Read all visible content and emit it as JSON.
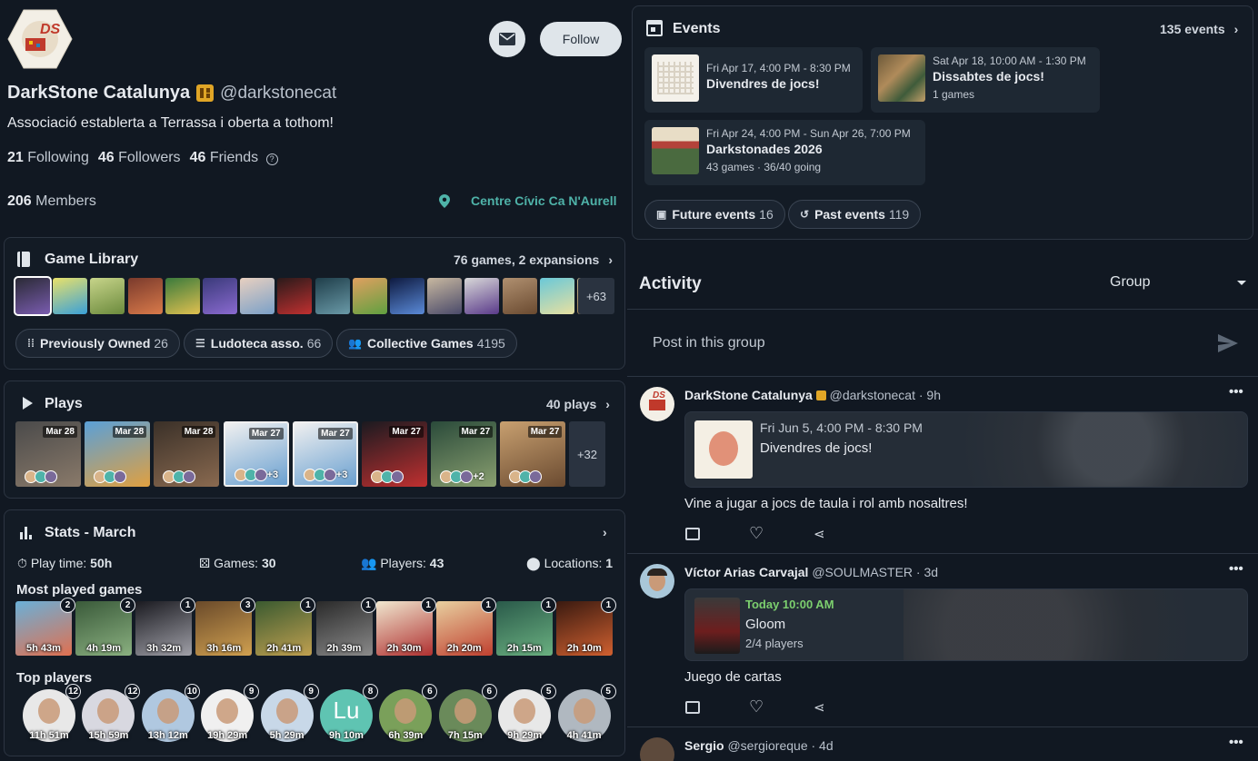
{
  "profile": {
    "name": "DarkStone Catalunya",
    "handle": "@darkstonecat",
    "bio": "Associació establerta a Terrassa i oberta a tothom!",
    "following_count": "21",
    "following_label": "Following",
    "followers_count": "46",
    "followers_label": "Followers",
    "friends_count": "46",
    "friends_label": "Friends",
    "members_count": "206",
    "members_label": "Members",
    "location": "Centre Cívic Ca N'Aurell",
    "follow_label": "Follow",
    "logo_text": "DS"
  },
  "events": {
    "title": "Events",
    "count_label": "135 events",
    "items": [
      {
        "date": "Fri Apr 17, 4:00 PM - 8:30 PM",
        "name": "Divendres de jocs!",
        "sub": ""
      },
      {
        "date": "Sat Apr 18, 10:00 AM - 1:30 PM",
        "name": "Dissabtes de jocs!",
        "sub": "1 games"
      },
      {
        "date": "Fri Apr 24, 4:00 PM - Sun Apr 26, 7:00 PM",
        "name": "Darkstonades 2026",
        "sub": "43 games · 36/40 going"
      }
    ],
    "future_label": "Future events",
    "future_count": "16",
    "past_label": "Past events",
    "past_count": "119"
  },
  "library": {
    "title": "Game Library",
    "count_label": "76 games, 2 expansions",
    "more": "+63",
    "chips": [
      {
        "label": "Previously Owned",
        "count": "26"
      },
      {
        "label": "Ludoteca asso.",
        "count": "66"
      },
      {
        "label": "Collective Games",
        "count": "4195"
      }
    ]
  },
  "plays": {
    "title": "Plays",
    "count_label": "40 plays",
    "more": "+32",
    "dates": [
      "Mar 28",
      "Mar 28",
      "Mar 28",
      "Mar 27",
      "Mar 27",
      "Mar 27",
      "Mar 27",
      "Mar 27"
    ],
    "extra": [
      "",
      "",
      "",
      "+3",
      "+3",
      "",
      "+2",
      ""
    ]
  },
  "stats": {
    "title": "Stats - March",
    "playtime_label": "Play time:",
    "playtime": "50h",
    "games_label": "Games:",
    "games": "30",
    "players_label": "Players:",
    "players": "43",
    "locations_label": "Locations:",
    "locations": "1",
    "most_played_title": "Most played games",
    "most_played": [
      {
        "time": "5h 43m",
        "count": "2"
      },
      {
        "time": "4h 19m",
        "count": "2"
      },
      {
        "time": "3h 32m",
        "count": "1"
      },
      {
        "time": "3h 16m",
        "count": "3"
      },
      {
        "time": "2h 41m",
        "count": "1"
      },
      {
        "time": "2h 39m",
        "count": "1"
      },
      {
        "time": "2h 30m",
        "count": "1"
      },
      {
        "time": "2h 20m",
        "count": "1"
      },
      {
        "time": "2h 15m",
        "count": "1"
      },
      {
        "time": "2h 10m",
        "count": "1"
      }
    ],
    "top_players_title": "Top players",
    "top_players": [
      {
        "time": "11h 51m",
        "count": "12",
        "initials": ""
      },
      {
        "time": "15h 59m",
        "count": "12",
        "initials": ""
      },
      {
        "time": "13h 12m",
        "count": "10",
        "initials": ""
      },
      {
        "time": "19h 29m",
        "count": "9",
        "initials": ""
      },
      {
        "time": "5h 29m",
        "count": "9",
        "initials": ""
      },
      {
        "time": "9h 10m",
        "count": "8",
        "initials": "Lu"
      },
      {
        "time": "6h 39m",
        "count": "6",
        "initials": ""
      },
      {
        "time": "7h 15m",
        "count": "6",
        "initials": ""
      },
      {
        "time": "9h 29m",
        "count": "5",
        "initials": ""
      },
      {
        "time": "4h 41m",
        "count": "5",
        "initials": ""
      }
    ]
  },
  "activity": {
    "title": "Activity",
    "filter": "Group",
    "post_placeholder": "Post in this group",
    "posts": [
      {
        "name": "DarkStone Catalunya",
        "handle": "@darkstonecat · 9h",
        "event_date": "Fri Jun 5, 4:00 PM - 8:30 PM",
        "event_name": "Divendres de jocs!",
        "event_sub": "",
        "text": "Vine a jugar a jocs de taula i rol amb nosaltres!"
      },
      {
        "name": "Víctor Arias Carvajal",
        "handle": "@SOULMASTER · 3d",
        "event_date": "Today 10:00 AM",
        "event_name": "Gloom",
        "event_sub": "2/4 players",
        "text": "Juego de cartas"
      },
      {
        "name": "Sergio",
        "handle": "@sergioreque · 4d"
      }
    ]
  },
  "colors": {
    "accent_teal": "#4fb3a9",
    "today_green": "#7ccf6e",
    "background": "#111822",
    "card": "#131b25"
  }
}
